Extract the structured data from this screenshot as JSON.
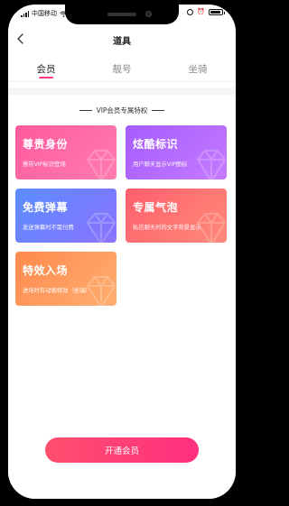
{
  "status_bar": {
    "carrier": "中国移动",
    "wifi_icon": "wifi-icon",
    "alarm_icon": "alarm-icon",
    "battery_level": 0.9
  },
  "nav": {
    "title": "道具",
    "back_icon": "chevron-left-icon"
  },
  "tabs": [
    {
      "label": "会员",
      "active": true
    },
    {
      "label": "靓号",
      "active": false
    },
    {
      "label": "坐骑",
      "active": false
    }
  ],
  "section": {
    "title": "VIP会员专属特权"
  },
  "cards": [
    {
      "title": "尊贵身份",
      "desc": "携带VIP标识登场",
      "color": "#ff5a9e"
    },
    {
      "title": "炫酷标识",
      "desc": "用户聊天显示VIP图标",
      "color": "#a45cff"
    },
    {
      "title": "免费弹幕",
      "desc": "发送弹幕时不需付费",
      "color": "#5a8dff"
    },
    {
      "title": "专属气泡",
      "desc": "私信聊天时的文字背景显示",
      "color": "#ff5f6d"
    },
    {
      "title": "特效入场",
      "desc": "进场时有动画特效（坐骑）",
      "color": "#ff8a4c"
    }
  ],
  "footer": {
    "open_label": "开通会员",
    "button_color": "#ff3d7a"
  }
}
